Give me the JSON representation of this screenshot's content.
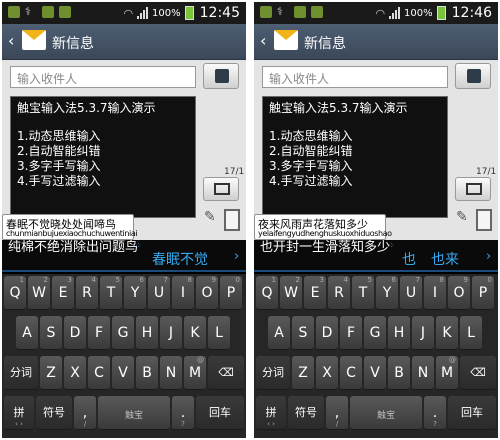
{
  "screens": [
    {
      "status": {
        "battery": "100%",
        "time": "12:45",
        "usb_glyph": "⚕"
      },
      "header": {
        "back_glyph": "‹",
        "title": "新信息"
      },
      "compose": {
        "recipient_placeholder": "输入收件人",
        "message_lines": [
          "触宝输入法5.3.7输入演示",
          "",
          "1.动态思维输入",
          "2.自动智能纠错",
          "3.多字手写输入",
          "4.手写过滤输入"
        ],
        "counter": "17/1",
        "attach_glyph": "✎"
      },
      "composition": {
        "phrase": "春眠不觉晓处处闻啼鸟",
        "pinyin": "chunmianbujuexiaochuchuwentiniai"
      },
      "candidates": {
        "main": "纯棉不绝消除出问题鸟",
        "dots": "⁘",
        "alt": [
          "春眠不觉"
        ],
        "arrow": "›"
      }
    },
    {
      "status": {
        "battery": "100%",
        "time": "12:46",
        "usb_glyph": "⚕"
      },
      "header": {
        "back_glyph": "‹",
        "title": "新信息"
      },
      "compose": {
        "recipient_placeholder": "输入收件人",
        "message_lines": [
          "触宝输入法5.3.7输入演示",
          "",
          "1.动态思维输入",
          "2.自动智能纠错",
          "3.多字手写输入",
          "4.手写过滤输入"
        ],
        "counter": "17/1",
        "attach_glyph": "✎"
      },
      "composition": {
        "phrase": "夜来风雨声花落知多少",
        "pinyin": "yelaifengyudhenghuskuoxhiduoshao"
      },
      "candidates": {
        "main": "也开封一生滑落知多少",
        "dots": "⁘",
        "alt": [
          "也",
          "也来"
        ],
        "arrow": "›"
      }
    }
  ],
  "keyboard": {
    "row1": [
      "Q",
      "W",
      "E",
      "R",
      "T",
      "Y",
      "U",
      "I",
      "O",
      "P"
    ],
    "row1_hints": [
      "1",
      "2",
      "3",
      "4",
      "5",
      "6",
      "7",
      "8",
      "9",
      "0"
    ],
    "row2": [
      "A",
      "S",
      "D",
      "F",
      "G",
      "H",
      "J",
      "K",
      "L"
    ],
    "row3": [
      "分词",
      "Z",
      "X",
      "C",
      "V",
      "B",
      "N",
      "M",
      "⌫"
    ],
    "row3_m_hint": "@",
    "row4": [
      "拼",
      "符号",
      ",",
      "触宝",
      ".",
      "回车"
    ],
    "comma_sub": "/",
    "period_sub": "?",
    "pin_sub": "‹ ›"
  },
  "icons": {
    "wifi": "wifi-icon",
    "signal": "signal-icon",
    "battery": "battery-icon",
    "contact": "contact-icon",
    "send": "send-message-icon",
    "attach": "attach-icon",
    "document": "document-icon",
    "envelope": "message-envelope-icon",
    "backspace": "backspace-icon"
  },
  "colors": {
    "title_bar": "#4e5e73",
    "candidate_alt": "#35a8f0",
    "battery": "#79c43a",
    "keyboard_bg": "#262626"
  }
}
